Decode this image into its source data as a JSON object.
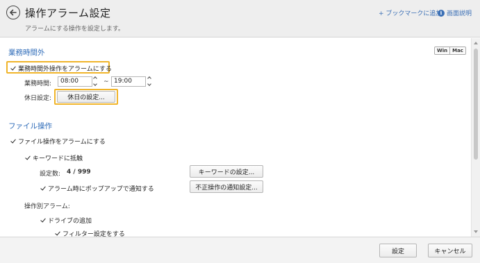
{
  "header": {
    "title": "操作アラーム設定",
    "subtitle": "アラームにする操作を設定します。",
    "bookmark_link": "+ ブックマークに追加",
    "help_link": "画面説明",
    "back_icon": "back-arrow-circle-icon",
    "help_icon": "info-icon"
  },
  "os_switch": {
    "win": "Win",
    "mac": "Mac"
  },
  "off_hours": {
    "title": "業務時間外",
    "checkbox_label": "業務時間外操作をアラームにする",
    "business_hours_label": "業務時間:",
    "start_time": "08:00",
    "separator": "~",
    "end_time": "19:00",
    "holiday_label": "休日設定:",
    "holiday_button": "休日の設定..."
  },
  "file_ops": {
    "title": "ファイル操作",
    "checkbox_label": "ファイル操作をアラームにする",
    "keyword_checkbox": "キーワードに抵触",
    "setting_count_label": "設定数:",
    "setting_count_value": "4 / 999",
    "keyword_button": "キーワードの設定...",
    "popup_checkbox": "アラーム時にポップアップで通知する",
    "notify_button": "不正操作の通知設定...",
    "per_op_label": "操作別アラーム:",
    "drive_add_checkbox": "ドライブの追加",
    "filter_checkbox": "フィルター設定をする"
  },
  "footer": {
    "ok": "設定",
    "cancel": "キャンセル"
  },
  "colors": {
    "accent": "#2e6bb8",
    "highlight": "#f0b429",
    "header_bg": "#eeeeee"
  }
}
